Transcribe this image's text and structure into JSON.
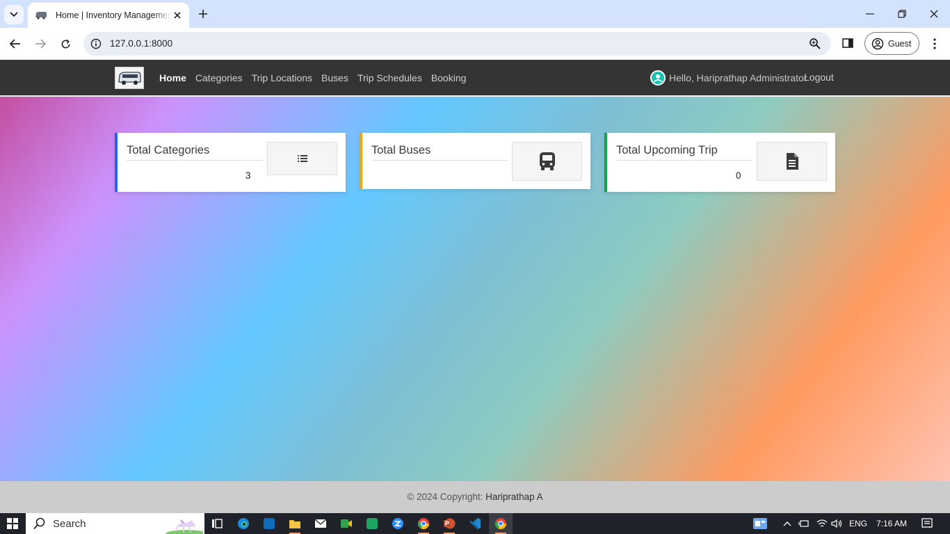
{
  "browser": {
    "tab_title": "Home | Inventory Management",
    "url": "127.0.0.1:8000",
    "profile_label": "Guest"
  },
  "navbar": {
    "links": [
      {
        "label": "Home",
        "active": true
      },
      {
        "label": "Categories"
      },
      {
        "label": "Trip Locations"
      },
      {
        "label": "Buses"
      },
      {
        "label": "Trip Schedules"
      },
      {
        "label": "Booking"
      }
    ],
    "user_greeting": "Hello, Hariprathap Administrator",
    "logout_label": "Logout"
  },
  "cards": [
    {
      "title": "Total Categories",
      "value": "3",
      "accent": "#2563eb",
      "icon": "list-icon"
    },
    {
      "title": "Total Buses",
      "value": "",
      "accent": "#f0a30a",
      "icon": "bus-icon"
    },
    {
      "title": "Total Upcoming Trip",
      "value": "0",
      "accent": "#16a34a",
      "icon": "document-icon"
    }
  ],
  "footer": {
    "copyright": "© 2024 Copyright: ",
    "author": "Hariprathap A"
  },
  "taskbar": {
    "search_label": "Search",
    "language": "ENG",
    "time": "7:16 AM"
  }
}
